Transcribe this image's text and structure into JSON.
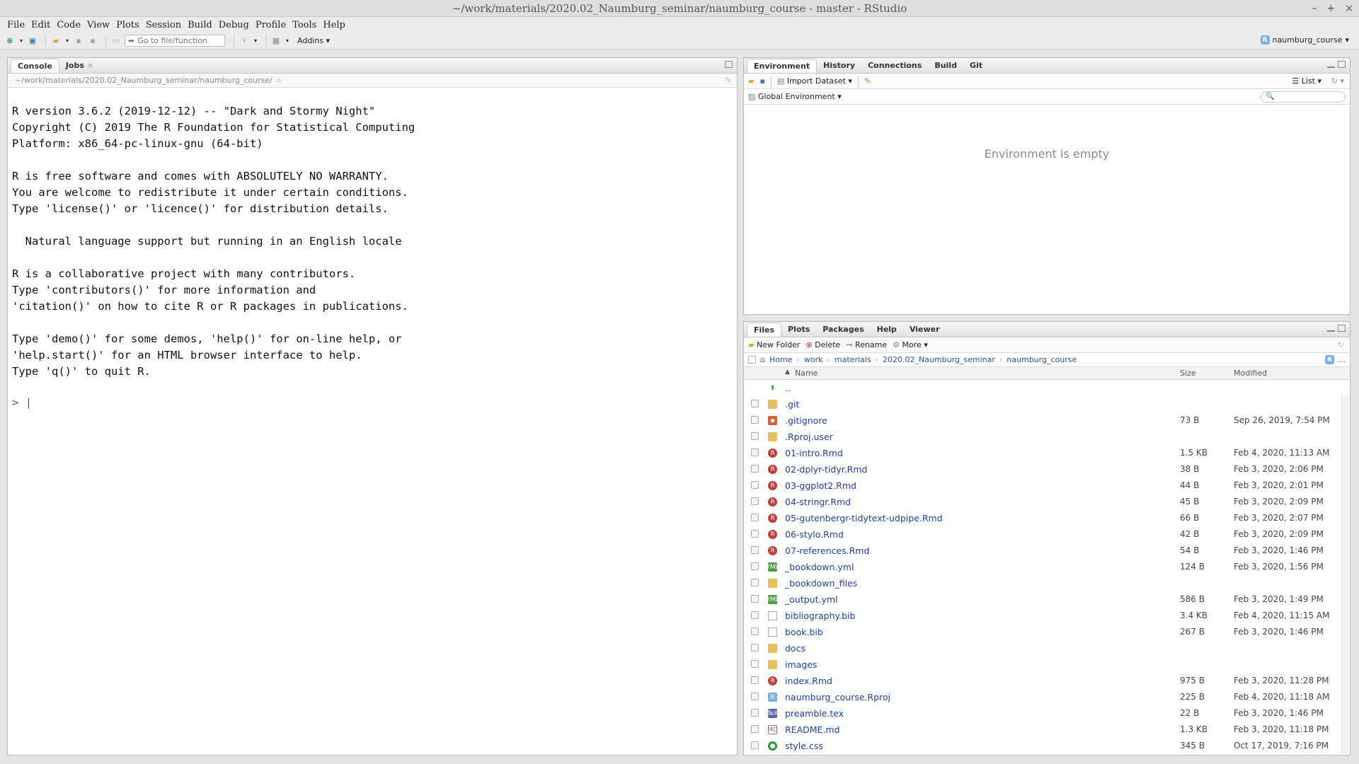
{
  "window": {
    "title": "~/work/materials/2020.02_Naumburg_seminar/naumburg_course - master - RStudio"
  },
  "menu": [
    "File",
    "Edit",
    "Code",
    "View",
    "Plots",
    "Session",
    "Build",
    "Debug",
    "Profile",
    "Tools",
    "Help"
  ],
  "toolbar": {
    "goto_placeholder": "Go to file/function",
    "addins": "Addins",
    "project": "naumburg_course"
  },
  "console": {
    "tabs": [
      "Console",
      "Jobs"
    ],
    "path": "~/work/materials/2020.02_Naumburg_seminar/naumburg_course/",
    "text": "R version 3.6.2 (2019-12-12) -- \"Dark and Stormy Night\"\nCopyright (C) 2019 The R Foundation for Statistical Computing\nPlatform: x86_64-pc-linux-gnu (64-bit)\n\nR is free software and comes with ABSOLUTELY NO WARRANTY.\nYou are welcome to redistribute it under certain conditions.\nType 'license()' or 'licence()' for distribution details.\n\n  Natural language support but running in an English locale\n\nR is a collaborative project with many contributors.\nType 'contributors()' for more information and\n'citation()' on how to cite R or R packages in publications.\n\nType 'demo()' for some demos, 'help()' for on-line help, or\n'help.start()' for an HTML browser interface to help.\nType 'q()' to quit R.",
    "prompt": ">"
  },
  "env": {
    "tabs": [
      "Environment",
      "History",
      "Connections",
      "Build",
      "Git"
    ],
    "import_dataset": "Import Dataset",
    "view_mode": "List",
    "scope": "Global Environment",
    "empty_message": "Environment is empty"
  },
  "files": {
    "tabs": [
      "Files",
      "Plots",
      "Packages",
      "Help",
      "Viewer"
    ],
    "actions": {
      "new_folder": "New Folder",
      "delete": "Delete",
      "rename": "Rename",
      "more": "More"
    },
    "breadcrumb": [
      "Home",
      "work",
      "materials",
      "2020.02_Naumburg_seminar",
      "naumburg_course"
    ],
    "columns": {
      "name": "Name",
      "size": "Size",
      "modified": "Modified"
    },
    "rows": [
      {
        "name": "..",
        "size": "",
        "modified": "",
        "icon": "up-arrow-icon",
        "kind": "up"
      },
      {
        "name": ".git",
        "size": "",
        "modified": "",
        "icon": "folder-icon",
        "kind": "folder"
      },
      {
        "name": ".gitignore",
        "size": "73 B",
        "modified": "Sep 26, 2019, 7:54 PM",
        "icon": "git-file-icon",
        "kind": "git"
      },
      {
        "name": ".Rproj.user",
        "size": "",
        "modified": "",
        "icon": "folder-icon",
        "kind": "folder"
      },
      {
        "name": "01-intro.Rmd",
        "size": "1.5 KB",
        "modified": "Feb 4, 2020, 11:13 AM",
        "icon": "rmd-file-icon",
        "kind": "rmd"
      },
      {
        "name": "02-dplyr-tidyr.Rmd",
        "size": "38 B",
        "modified": "Feb 3, 2020, 2:06 PM",
        "icon": "rmd-file-icon",
        "kind": "rmd"
      },
      {
        "name": "03-ggplot2.Rmd",
        "size": "44 B",
        "modified": "Feb 3, 2020, 2:01 PM",
        "icon": "rmd-file-icon",
        "kind": "rmd"
      },
      {
        "name": "04-stringr.Rmd",
        "size": "45 B",
        "modified": "Feb 3, 2020, 2:09 PM",
        "icon": "rmd-file-icon",
        "kind": "rmd"
      },
      {
        "name": "05-gutenbergr-tidytext-udpipe.Rmd",
        "size": "66 B",
        "modified": "Feb 3, 2020, 2:07 PM",
        "icon": "rmd-file-icon",
        "kind": "rmd"
      },
      {
        "name": "06-stylo.Rmd",
        "size": "42 B",
        "modified": "Feb 3, 2020, 2:09 PM",
        "icon": "rmd-file-icon",
        "kind": "rmd"
      },
      {
        "name": "07-references.Rmd",
        "size": "54 B",
        "modified": "Feb 3, 2020, 1:46 PM",
        "icon": "rmd-file-icon",
        "kind": "rmd"
      },
      {
        "name": "_bookdown.yml",
        "size": "124 B",
        "modified": "Feb 3, 2020, 1:56 PM",
        "icon": "yml-file-icon",
        "kind": "yml"
      },
      {
        "name": "_bookdown_files",
        "size": "",
        "modified": "",
        "icon": "folder-icon",
        "kind": "folder"
      },
      {
        "name": "_output.yml",
        "size": "586 B",
        "modified": "Feb 3, 2020, 1:49 PM",
        "icon": "yml-file-icon",
        "kind": "yml"
      },
      {
        "name": "bibliography.bib",
        "size": "3.4 KB",
        "modified": "Feb 4, 2020, 11:15 AM",
        "icon": "text-file-icon",
        "kind": "plain"
      },
      {
        "name": "book.bib",
        "size": "267 B",
        "modified": "Feb 3, 2020, 1:46 PM",
        "icon": "text-file-icon",
        "kind": "plain"
      },
      {
        "name": "docs",
        "size": "",
        "modified": "",
        "icon": "folder-icon",
        "kind": "folder"
      },
      {
        "name": "images",
        "size": "",
        "modified": "",
        "icon": "folder-icon",
        "kind": "folder"
      },
      {
        "name": "index.Rmd",
        "size": "975 B",
        "modified": "Feb 3, 2020, 11:28 PM",
        "icon": "rmd-file-icon",
        "kind": "rmd"
      },
      {
        "name": "naumburg_course.Rproj",
        "size": "225 B",
        "modified": "Feb 4, 2020, 11:18 AM",
        "icon": "rproj-file-icon",
        "kind": "proj"
      },
      {
        "name": "preamble.tex",
        "size": "22 B",
        "modified": "Feb 3, 2020, 1:46 PM",
        "icon": "tex-file-icon",
        "kind": "tex"
      },
      {
        "name": "README.md",
        "size": "1.3 KB",
        "modified": "Feb 3, 2020, 11:18 PM",
        "icon": "md-file-icon",
        "kind": "md"
      },
      {
        "name": "style.css",
        "size": "345 B",
        "modified": "Oct 17, 2019, 7:16 PM",
        "icon": "css-file-icon",
        "kind": "css"
      }
    ]
  }
}
